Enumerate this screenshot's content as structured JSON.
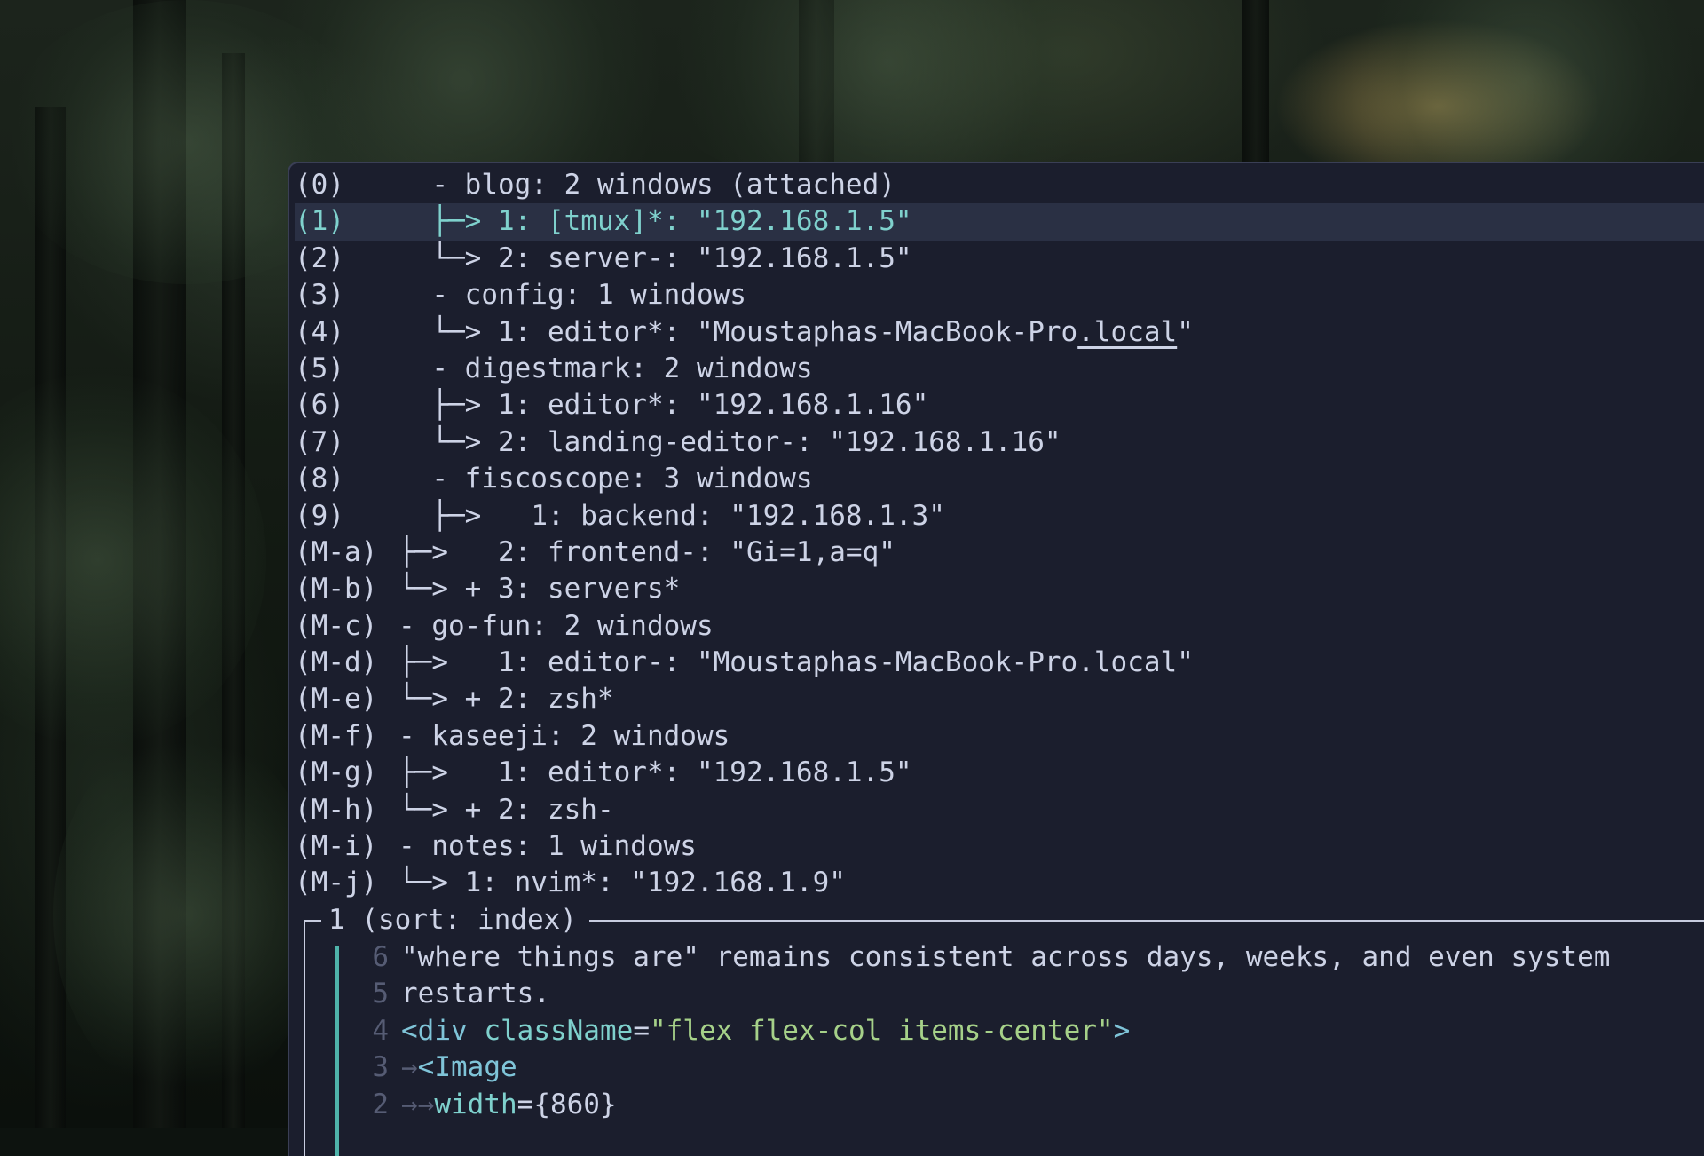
{
  "tree": [
    {
      "key": "(0)",
      "glyph": "  - ",
      "text": "blog: 2 windows (attached)",
      "selected": false
    },
    {
      "key": "(1)",
      "glyph": "  ├─> ",
      "text": "1: [tmux]*: \"192.168.1.5\"",
      "selected": true
    },
    {
      "key": "(2)",
      "glyph": "  └─> ",
      "text": "2: server-: \"192.168.1.5\"",
      "selected": false
    },
    {
      "key": "(3)",
      "glyph": "  - ",
      "text": "config: 1 windows",
      "selected": false
    },
    {
      "key": "(4)",
      "glyph": "  └─> ",
      "text": "1: editor*: \"Moustaphas-MacBook-Pro",
      "text_underlined": ".local",
      "text_after": "\"",
      "selected": false
    },
    {
      "key": "(5)",
      "glyph": "  - ",
      "text": "digestmark: 2 windows",
      "selected": false
    },
    {
      "key": "(6)",
      "glyph": "  ├─> ",
      "text": "1: editor*: \"192.168.1.16\"",
      "selected": false
    },
    {
      "key": "(7)",
      "glyph": "  └─> ",
      "text": "2: landing-editor-: \"192.168.1.16\"",
      "selected": false
    },
    {
      "key": "(8)",
      "glyph": "  - ",
      "text": "fiscoscope: 3 windows",
      "selected": false
    },
    {
      "key": "(9)",
      "glyph": "  ├─>   ",
      "text": "1: backend: \"192.168.1.3\"",
      "selected": false
    },
    {
      "key": "(M-a)",
      "glyph": "├─>   ",
      "text": "2: frontend-: \"Gi=1,a=q\"",
      "selected": false
    },
    {
      "key": "(M-b)",
      "glyph": "└─> + ",
      "text": "3: servers*",
      "selected": false
    },
    {
      "key": "(M-c)",
      "glyph": "- ",
      "text": "go-fun: 2 windows",
      "selected": false
    },
    {
      "key": "(M-d)",
      "glyph": "├─>   ",
      "text": "1: editor-: \"Moustaphas-MacBook-Pro.local\"",
      "selected": false
    },
    {
      "key": "(M-e)",
      "glyph": "└─> + ",
      "text": "2: zsh*",
      "selected": false
    },
    {
      "key": "(M-f)",
      "glyph": "- ",
      "text": "kaseeji: 2 windows",
      "selected": false
    },
    {
      "key": "(M-g)",
      "glyph": "├─>   ",
      "text": "1: editor*: \"192.168.1.5\"",
      "selected": false
    },
    {
      "key": "(M-h)",
      "glyph": "└─> + ",
      "text": "2: zsh-",
      "selected": false
    },
    {
      "key": "(M-i)",
      "glyph": "- ",
      "text": "notes: 1 windows",
      "selected": false
    },
    {
      "key": "(M-j)",
      "glyph": "└─> ",
      "text": "1: nvim*: \"192.168.1.9\"",
      "selected": false
    }
  ],
  "preview": {
    "title": "1 (sort: index)",
    "lines": [
      {
        "num": "6",
        "parts": [
          {
            "cls": "c-text",
            "t": "\"where things are\" remains consistent across days, weeks, and even system"
          }
        ]
      },
      {
        "num": "5",
        "parts": [
          {
            "cls": "c-text",
            "t": "restarts."
          }
        ]
      },
      {
        "num": "4",
        "parts": [
          {
            "cls": "c-tag",
            "t": "<div "
          },
          {
            "cls": "c-attr",
            "t": "className"
          },
          {
            "cls": "c-punct",
            "t": "="
          },
          {
            "cls": "c-str",
            "t": "\"flex flex-col items-center\""
          },
          {
            "cls": "c-tag",
            "t": ">"
          }
        ]
      },
      {
        "num": "3",
        "parts": [
          {
            "cls": "tabarrow",
            "t": "→"
          },
          {
            "cls": "c-tag",
            "t": "<Image"
          }
        ]
      },
      {
        "num": "2",
        "parts": [
          {
            "cls": "tabarrow",
            "t": "→→"
          },
          {
            "cls": "c-attr",
            "t": "width"
          },
          {
            "cls": "c-punct",
            "t": "={860}"
          }
        ]
      }
    ]
  },
  "colors": {
    "background": "#1b1e2d",
    "foreground": "#cdd3e6",
    "selection_bg": "#2a3044",
    "selection_fg": "#7fd1cd",
    "accent": "#4fb3aa"
  }
}
